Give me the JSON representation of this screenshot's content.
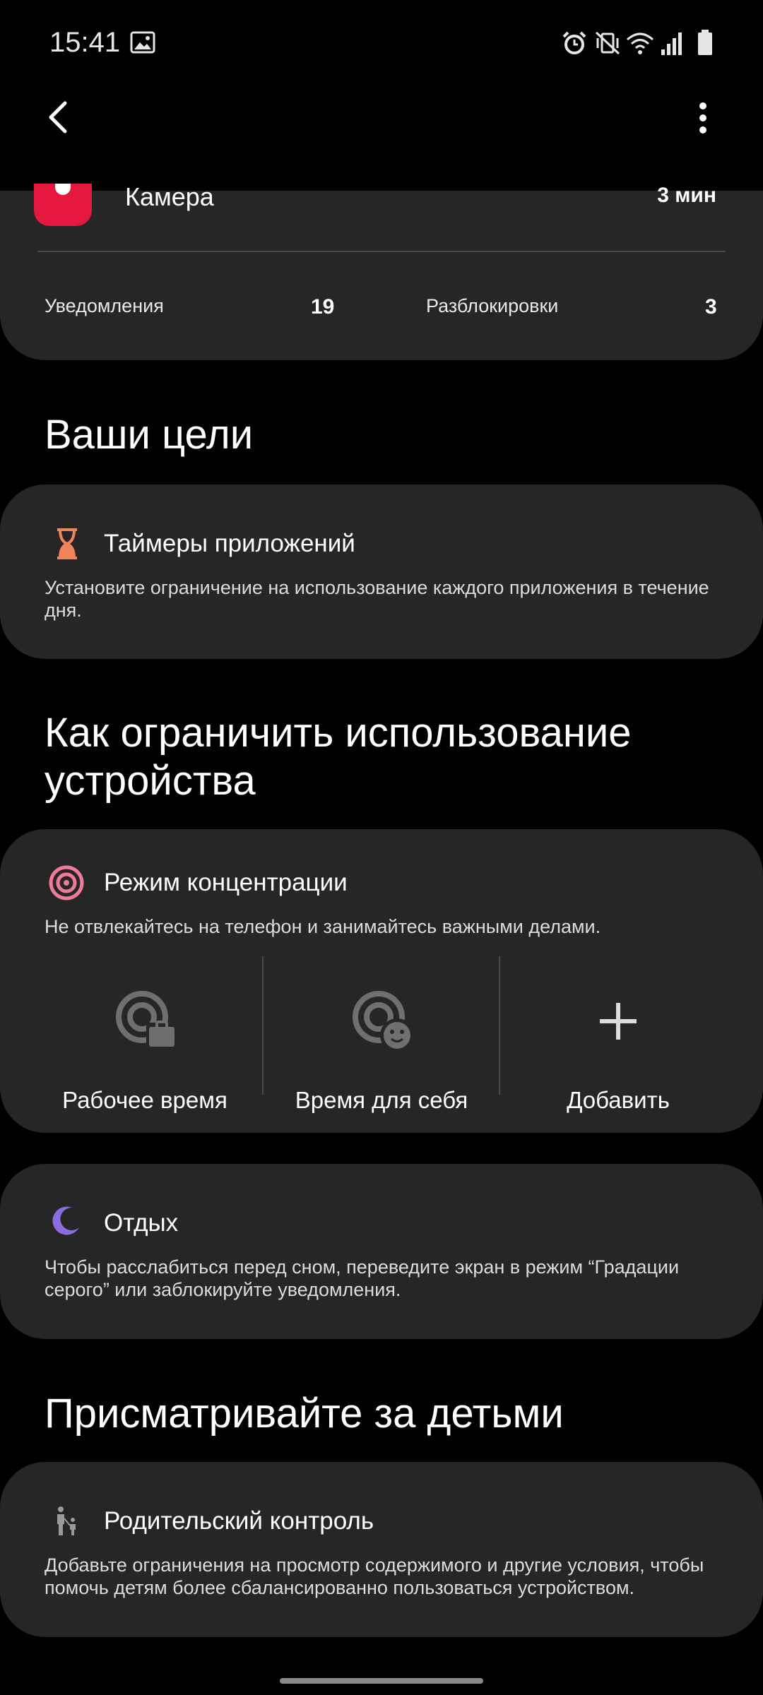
{
  "status_bar": {
    "time": "15:41"
  },
  "usage_card": {
    "app_name": "Камера",
    "app_time": "3 мин",
    "notifications_label": "Уведомления",
    "notifications_count": "19",
    "unlocks_label": "Разблокировки",
    "unlocks_count": "3"
  },
  "goals": {
    "section_title": "Ваши цели",
    "app_timers": {
      "title": "Таймеры приложений",
      "description": "Установите ограничение на использование каждого приложения в течение дня."
    }
  },
  "limit": {
    "section_title": "Как ограничить использование устройства",
    "focus_mode": {
      "title": "Режим концентрации",
      "description": "Не отвлекайтесь на телефон и занимайтесь важными делами.",
      "options": [
        "Рабочее время",
        "Время для себя",
        "Добавить"
      ]
    },
    "wind_down": {
      "title": "Отдых",
      "description": "Чтобы расслабиться перед сном, переведите экран в режим “Градации серого” или заблокируйте уведомления."
    }
  },
  "kids": {
    "section_title": "Присматривайте за детьми",
    "parental_controls": {
      "title": "Родительский контроль",
      "description": "Добавьте ограничения на просмотр содержимого и другие условия, чтобы помочь детям более сбалансированно пользоваться устройством."
    }
  },
  "colors": {
    "background": "#000000",
    "card": "#262626",
    "camera_icon": "#e5183f",
    "hourglass_icon": "#f0855c",
    "focus_icon": "#f07a9a",
    "moon_icon": "#8d6be0"
  }
}
